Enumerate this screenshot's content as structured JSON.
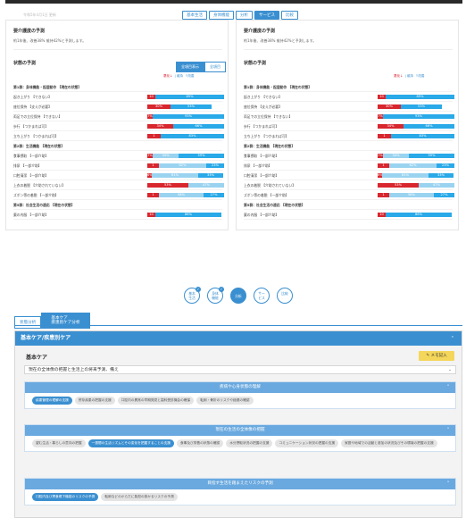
{
  "top": {
    "header_faint": "令和5年4月1日 更新",
    "nav": [
      {
        "label": "基本生活",
        "active": false
      },
      {
        "label": "身体機能",
        "active": false
      },
      {
        "label": "分析",
        "active": false
      },
      {
        "label": "サービス",
        "active": true
      },
      {
        "label": "比較",
        "active": false
      }
    ],
    "left": {
      "prediction_title": "要介護度の予測",
      "prediction_text": "約1年後、改善38% 維持42%と予測します。",
      "status_title": "状態の予測",
      "toggle_on": "全項目表示",
      "toggle_off": "全項目",
      "legend_worse": "悪化↓",
      "legend_keep": "維持",
      "legend_better": "↑改善",
      "rows": [
        {
          "label": "第1群：身体機能・起居動作 【現在の状態】",
          "group": true
        },
        {
          "label": "起き上がり 【できない】",
          "red": 10,
          "gray": 0,
          "blue": 89,
          "red_t": "10",
          "blue_t": "89%"
        },
        {
          "label": "座位保持 【支えが必要】",
          "red": 30,
          "gray": 0,
          "blue": 53,
          "red_t": "30%",
          "blue_t": "53%"
        },
        {
          "label": "両足での立位保持 【できない】",
          "red": 7,
          "gray": 0,
          "blue": 93,
          "red_t": "7%",
          "blue_t": "93%"
        },
        {
          "label": "歩行 【つかまれば可】",
          "red": 34,
          "gray": 0,
          "blue": 66,
          "red_t": "34%",
          "blue_t": "66%"
        },
        {
          "label": "立ち上がり 【つかまれば可】",
          "red": 17,
          "gray": 0,
          "blue": 83,
          "red_t": "1",
          "blue_t": "83%"
        },
        {
          "label": "第2群：生活機能 【現在の状態】",
          "group": true
        },
        {
          "label": "食事摂取 【一部介助】",
          "red": 7,
          "gray": 34,
          "blue": 59,
          "red_t": "7%",
          "blue_t": "34%",
          "blue2_t": "59%"
        },
        {
          "label": "排尿 【一部介助】",
          "red": 15,
          "gray": 62,
          "blue": 23,
          "red_t": "1",
          "blue_t": "62%",
          "blue2_t": "23%"
        },
        {
          "label": "口腔清潔 【一部介助】",
          "red": 6,
          "gray": 61,
          "blue": 33,
          "red_t": "6%",
          "blue_t": "61%",
          "blue2_t": "33%"
        },
        {
          "label": "上衣の着脱 【介助されていない】",
          "red": 53,
          "gray": 47,
          "blue": 0,
          "red_t": "53%",
          "blue_t": "47%"
        },
        {
          "label": "ズボン等の着脱 【一部介助】",
          "red": 15,
          "gray": 58,
          "blue": 27,
          "red_t": "1",
          "blue_t": "58%",
          "blue2_t": "27%"
        },
        {
          "label": "第5群：社会生活の適応 【現在の状態】",
          "group": true
        },
        {
          "label": "薬の内服 【一部介助】",
          "red": 10,
          "gray": 0,
          "blue": 86,
          "red_t": "10",
          "blue_t": "86%"
        }
      ]
    },
    "right": {
      "prediction_title": "要介護度の予測",
      "prediction_text": "約1年後、改善38% 維持42%と予測します。",
      "status_title": "状態の予測",
      "legend_worse": "悪化↓",
      "legend_keep": "維持",
      "legend_better": "↑改善",
      "rows": [
        {
          "label": "第1群：身体機能・起居動作 【現在の状態】",
          "group": true
        },
        {
          "label": "起き上がり 【できない】",
          "red": 10,
          "gray": 0,
          "blue": 89,
          "red_t": "10",
          "blue_t": "89%"
        },
        {
          "label": "座位保持 【支えが必要】",
          "red": 30,
          "gray": 0,
          "blue": 53,
          "red_t": "30%",
          "blue_t": "53%"
        },
        {
          "label": "両足での立位保持 【できない】",
          "red": 7,
          "gray": 0,
          "blue": 93,
          "red_t": "7%",
          "blue_t": "93%"
        },
        {
          "label": "歩行 【つかまれば可】",
          "red": 34,
          "gray": 0,
          "blue": 66,
          "red_t": "34%",
          "blue_t": "66%"
        },
        {
          "label": "立ち上がり 【つかまれば可】",
          "red": 17,
          "gray": 0,
          "blue": 83,
          "red_t": "1",
          "blue_t": "83%"
        },
        {
          "label": "第2群：生活機能 【現在の状態】",
          "group": true
        },
        {
          "label": "食事摂取 【一部介助】",
          "red": 7,
          "gray": 34,
          "blue": 59,
          "red_t": "7%",
          "blue_t": "34%",
          "blue2_t": "59%"
        },
        {
          "label": "排尿 【一部介助】",
          "red": 15,
          "gray": 62,
          "blue": 23,
          "red_t": "1",
          "blue_t": "62%",
          "blue2_t": "23%"
        },
        {
          "label": "口腔清潔 【一部介助】",
          "red": 6,
          "gray": 61,
          "blue": 33,
          "red_t": "6%",
          "blue_t": "61%",
          "blue2_t": "33%"
        },
        {
          "label": "上衣の着脱 【介助されていない】",
          "red": 53,
          "gray": 47,
          "blue": 0,
          "red_t": "53%",
          "blue_t": "47%"
        },
        {
          "label": "ズボン等の着脱 【一部介助】",
          "red": 15,
          "gray": 58,
          "blue": 27,
          "red_t": "1",
          "blue_t": "58%",
          "blue2_t": "27%"
        },
        {
          "label": "第5群：社会生活の適応 【現在の状態】",
          "group": true
        },
        {
          "label": "薬の内服 【一部介助】",
          "red": 10,
          "gray": 0,
          "blue": 86,
          "red_t": "10",
          "blue_t": "86%"
        }
      ]
    }
  },
  "bottom": {
    "circles": [
      {
        "line1": "基本",
        "line2": "生活",
        "checked": true,
        "active": false
      },
      {
        "line1": "身体",
        "line2": "機能",
        "checked": true,
        "active": false
      },
      {
        "line1": "分析",
        "line2": "",
        "checked": false,
        "active": true
      },
      {
        "line1": "サー",
        "line2": "ビス",
        "checked": false,
        "active": false
      },
      {
        "line1": "比較",
        "line2": "",
        "checked": false,
        "active": false
      }
    ],
    "tabs": [
      {
        "label": "状態分析",
        "active": false
      },
      {
        "label": "基本ケア\n疾患別ケア分析",
        "active": true
      }
    ],
    "card_title": "基本ケア/疾患別ケア",
    "care_label": "基本ケア",
    "memo_button": "メモ記入",
    "select_value": "現在の全体像の把握と生活上の将来予測、備え",
    "sections": [
      {
        "title": "疾病や心身状態の理解",
        "chips": [
          {
            "label": "疾患管理の理解の支援",
            "sel": true
          },
          {
            "label": "併存疾患の把握の支援",
            "sel": false
          },
          {
            "label": "口腔内の異常の早期発見と歯科受診機会の確保",
            "sel": false
          },
          {
            "label": "転倒・骨折のリスクや経緯の確認",
            "sel": false
          }
        ]
      },
      {
        "title": "現在の生活の全体像の把握",
        "chips": [
          {
            "label": "望む生活・暮らしの意向の把握",
            "sel": false
          },
          {
            "label": "一週間の生活リズムとその変化を把握することの支援",
            "sel": true
          },
          {
            "label": "食事及び栄養の状態の確認",
            "sel": false
          },
          {
            "label": "水分摂取状況の把握の支援",
            "sel": false
          },
          {
            "label": "コミュニケーション状況の把握の支援",
            "sel": false
          },
          {
            "label": "家庭や地域での活動と参加の状況及びその環境の把握の支援",
            "sel": false
          }
        ]
      },
      {
        "title": "目指す生活を踏まえたリスクの予測",
        "chips": [
          {
            "label": "口腔内及び摂食嚥下機能のリスクの予測",
            "sel": true
          },
          {
            "label": "転倒などのからだに負担の掛かるリスクの予測",
            "sel": false
          }
        ]
      }
    ]
  }
}
